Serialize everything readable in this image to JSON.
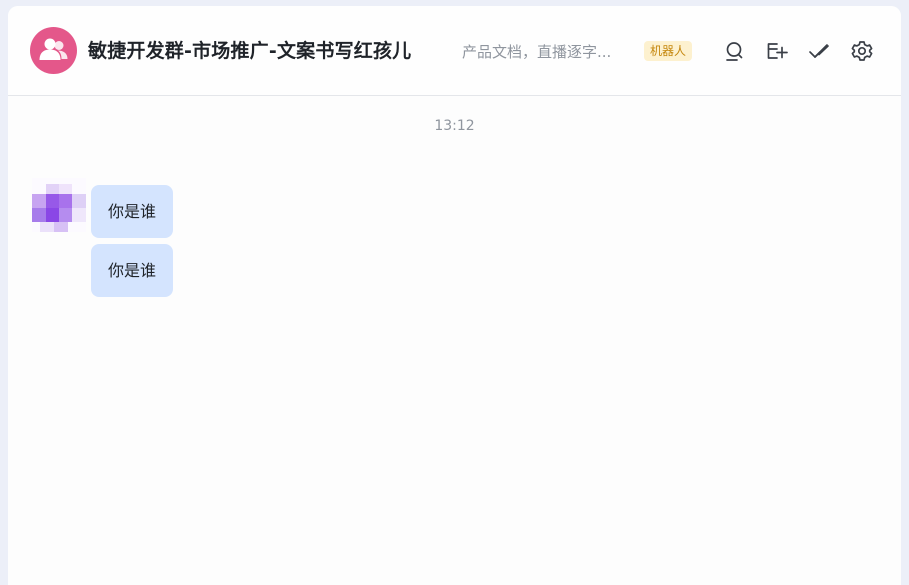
{
  "header": {
    "group_name": "敏捷开发群-市场推广-文案书写红孩儿",
    "description": "产品文档，直播逐字...",
    "bot_badge": "机器人",
    "avatar_icon": "group-users-icon",
    "tools": [
      "search-icon",
      "add-tab-icon",
      "checkmark-icon",
      "settings-gear-icon"
    ]
  },
  "chat": {
    "timestamp": "13:12",
    "messages": [
      {
        "text": "你是谁"
      },
      {
        "text": "你是谁"
      }
    ]
  },
  "colors": {
    "avatar_bg": "#e4578a",
    "bubble_bg": "#d4e4fe",
    "badge_bg": "#fdf1cf",
    "badge_text": "#c5870d",
    "page_bg": "#eceff8"
  }
}
